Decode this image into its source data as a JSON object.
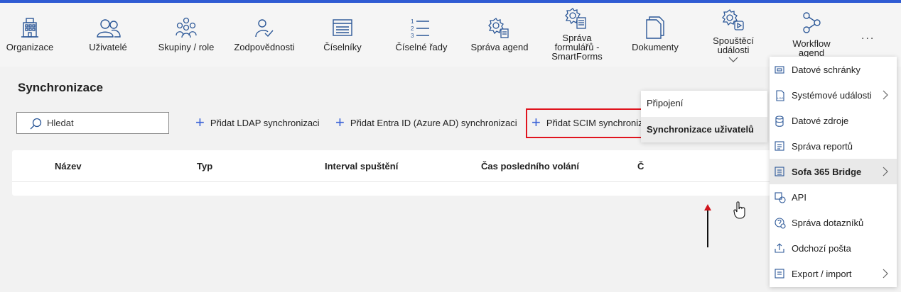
{
  "colors": {
    "accent": "#2f5bd3",
    "highlight_border": "#e0141e",
    "plus": "#3a62d6",
    "icon": "#2b5797"
  },
  "toolbar": {
    "items": [
      {
        "label": "Organizace",
        "icon": "building-icon"
      },
      {
        "label": "Uživatelé",
        "icon": "users-icon"
      },
      {
        "label": "Skupiny / role",
        "icon": "group-icon"
      },
      {
        "label": "Zodpovědnosti",
        "icon": "user-check-icon"
      },
      {
        "label": "Číselníky",
        "icon": "list-window-icon"
      },
      {
        "label": "Číselné řady",
        "icon": "numbered-list-icon"
      },
      {
        "label": "Správa agend",
        "icon": "gear-clipboard-icon"
      },
      {
        "label_lines": [
          "Správa",
          "formulářů -",
          "SmartForms"
        ],
        "icon": "gear-form-icon"
      },
      {
        "label": "Dokumenty",
        "icon": "documents-icon"
      },
      {
        "label_lines": [
          "Spouštěcí",
          "události"
        ],
        "icon": "gear-play-icon"
      },
      {
        "label_lines": [
          "Workflow",
          "agend"
        ],
        "icon": "share-nodes-icon"
      }
    ],
    "more": "..."
  },
  "page": {
    "title": "Synchronizace",
    "search_placeholder": "Hledat",
    "actions": [
      "Přidat LDAP synchronizaci",
      "Přidat Entra ID (Azure AD) synchronizaci",
      "Přidat SCIM synchronizaci"
    ],
    "plus": "+"
  },
  "table": {
    "columns": [
      "Název",
      "Typ",
      "Interval spuštění",
      "Čas posledního volání",
      "Č"
    ]
  },
  "submenu": {
    "items": [
      "Připojení",
      "Synchronizace uživatelů"
    ]
  },
  "dropdown": {
    "items": [
      {
        "label": "Datové schránky",
        "icon": "mailbox-icon",
        "has_submenu": false
      },
      {
        "label": "Systémové události",
        "icon": "log-file-icon",
        "has_submenu": true
      },
      {
        "label": "Datové zdroje",
        "icon": "database-icon",
        "has_submenu": false
      },
      {
        "label": "Správa reportů",
        "icon": "report-icon",
        "has_submenu": false
      },
      {
        "label": "Sofa 365 Bridge",
        "icon": "bridge-icon",
        "has_submenu": true,
        "active": true
      },
      {
        "label": "API",
        "icon": "api-icon",
        "has_submenu": false
      },
      {
        "label": "Správa dotazníků",
        "icon": "questionnaire-icon",
        "has_submenu": false
      },
      {
        "label": "Odchozí pošta",
        "icon": "outbox-icon",
        "has_submenu": false
      },
      {
        "label": "Export / import",
        "icon": "export-icon",
        "has_submenu": true
      }
    ]
  }
}
